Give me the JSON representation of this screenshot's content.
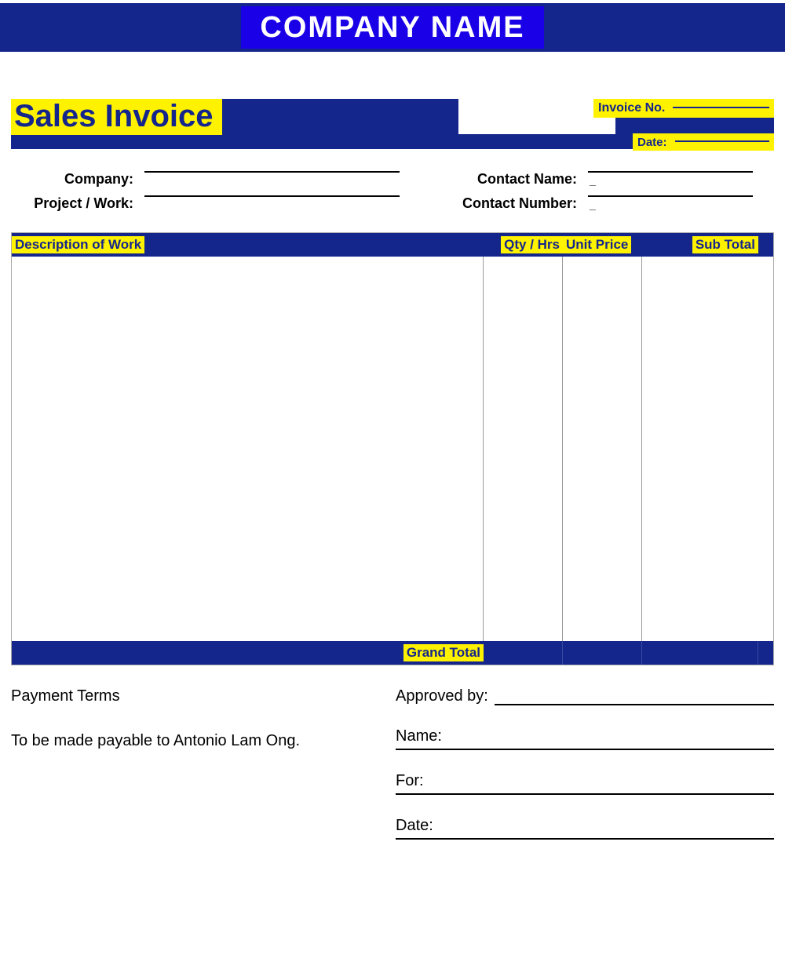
{
  "header": {
    "company_name": "COMPANY NAME"
  },
  "invoice": {
    "title": "Sales Invoice",
    "invoice_no_label": "Invoice No.",
    "invoice_no_value": "",
    "date_label": "Date:",
    "date_value": ""
  },
  "fields": {
    "company_label": "Company:",
    "company_value": "",
    "project_label": "Project / Work:",
    "project_value": "",
    "contact_name_label": "Contact Name:",
    "contact_name_value": "",
    "contact_number_label": "Contact Number:",
    "contact_number_value": ""
  },
  "table": {
    "headers": {
      "description": "Description of Work",
      "qty": "Qty / Hrs",
      "unit_price": "Unit Price",
      "sub_total": "Sub Total"
    },
    "rows": [],
    "grand_total_label": "Grand Total",
    "grand_total_value": ""
  },
  "footer": {
    "payment_terms_title": "Payment Terms",
    "payment_terms_body": "To be made payable to Antonio Lam Ong.",
    "approved_by_label": "Approved by:",
    "approved_by_value": "",
    "name_label": "Name:",
    "name_value": "",
    "for_label": "For:",
    "for_value": "",
    "date_label": "Date:",
    "date_value": ""
  }
}
